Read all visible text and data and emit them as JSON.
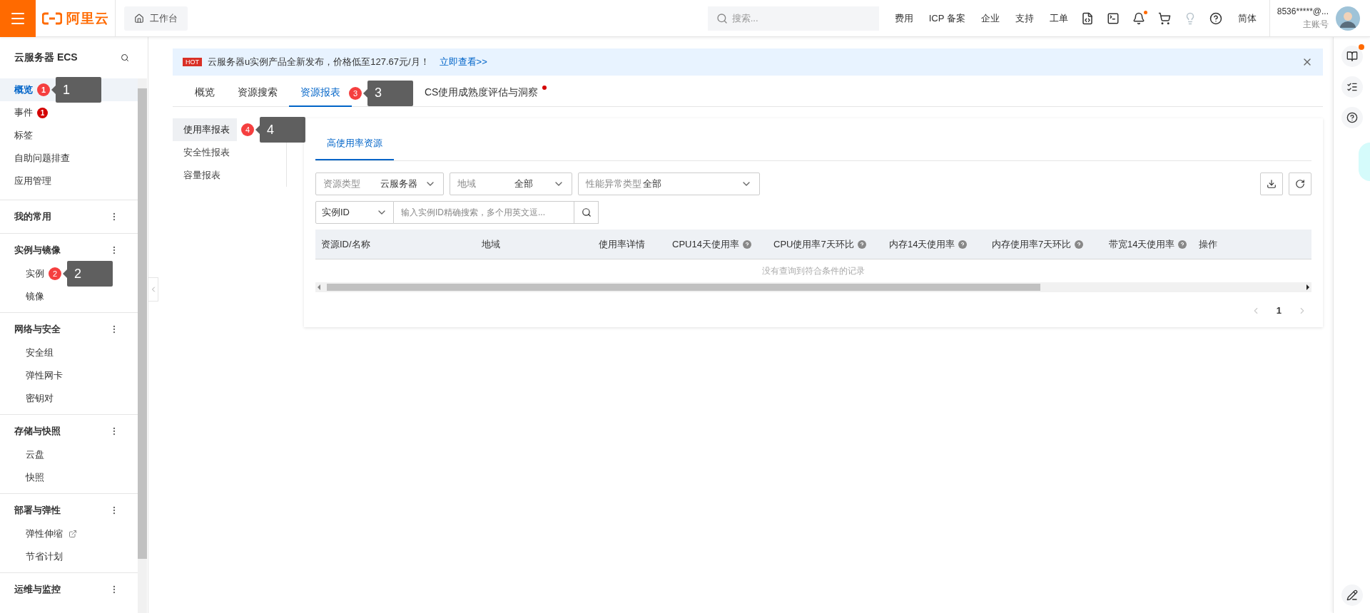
{
  "topbar": {
    "logo_text": "阿里云",
    "workbench": "工作台",
    "search": {
      "placeholder": "搜索..."
    },
    "nav_links": [
      "费用",
      "ICP 备案",
      "企业",
      "支持",
      "工单"
    ],
    "icon_buttons": [
      {
        "kind": "code",
        "dot": false,
        "disabled": false
      },
      {
        "kind": "terminal",
        "dot": false,
        "disabled": false
      },
      {
        "kind": "bell",
        "dot": true,
        "disabled": false
      },
      {
        "kind": "cart",
        "dot": false,
        "disabled": false
      },
      {
        "kind": "bulb",
        "dot": false,
        "disabled": true
      },
      {
        "kind": "help",
        "dot": false,
        "disabled": false
      }
    ],
    "language": "简体",
    "account": {
      "name": "8536*****@...",
      "role": "主账号"
    }
  },
  "sidebar": {
    "title": "云服务器 ECS",
    "items": [
      {
        "label": "概览",
        "selected": true,
        "annotation": {
          "badge": "1",
          "callout": "1"
        }
      },
      {
        "label": "事件",
        "selected": false,
        "count": "1"
      },
      {
        "label": "标签",
        "selected": false
      },
      {
        "label": "自助问题排查",
        "selected": false
      },
      {
        "label": "应用管理",
        "selected": false
      }
    ],
    "groups": [
      {
        "title": "我的常用"
      },
      {
        "title": "实例与镜像",
        "children": [
          {
            "label": "实例",
            "selected": false,
            "annotation": {
              "badge": "2",
              "callout": "2"
            }
          },
          {
            "label": "镜像",
            "selected": false
          }
        ]
      },
      {
        "title": "网络与安全",
        "children": [
          {
            "label": "安全组",
            "selected": false
          },
          {
            "label": "弹性网卡",
            "selected": false
          },
          {
            "label": "密钥对",
            "selected": false
          }
        ]
      },
      {
        "title": "存储与快照",
        "children": [
          {
            "label": "云盘",
            "selected": false
          },
          {
            "label": "快照",
            "selected": false
          }
        ]
      },
      {
        "title": "部署与弹性",
        "children": [
          {
            "label": "弹性伸缩",
            "selected": false,
            "external": true
          },
          {
            "label": "节省计划",
            "selected": false
          }
        ]
      },
      {
        "title": "运维与监控"
      }
    ]
  },
  "banner": {
    "tag": "HOT",
    "text": "云服务器u实例产品全新发布，价格低至127.67元/月！",
    "link": "立即查看>>"
  },
  "tabs": [
    {
      "label": "概览",
      "selected": false
    },
    {
      "label": "资源搜索",
      "selected": false
    },
    {
      "label": "资源报表",
      "selected": true,
      "annotation": {
        "badge": "3",
        "callout": "3"
      }
    },
    {
      "label": "CS使用成熟度评估与洞察",
      "selected": false,
      "dot": true
    }
  ],
  "subnav": [
    {
      "label": "使用率报表",
      "selected": true,
      "annotation": {
        "badge": "4",
        "callout": "4"
      }
    },
    {
      "label": "安全性报表",
      "selected": false
    },
    {
      "label": "容量报表",
      "selected": false
    }
  ],
  "panel": {
    "tabs": [
      {
        "label": "高使用率资源",
        "selected": true
      }
    ],
    "filters": [
      {
        "label": "资源类型",
        "value": "云服务器"
      },
      {
        "label": "地域",
        "value": "全部"
      },
      {
        "label": "性能异常类型",
        "value": "全部"
      }
    ],
    "id_type": "实例ID",
    "id_search": {
      "placeholder": "输入实例ID精确搜索，多个用英文逗..."
    },
    "table": {
      "columns": [
        {
          "label": "资源ID/名称",
          "help": false
        },
        {
          "label": "地域",
          "help": false
        },
        {
          "label": "使用率详情",
          "help": false
        },
        {
          "label": "CPU14天使用率",
          "help": true
        },
        {
          "label": "CPU使用率7天环比",
          "help": true
        },
        {
          "label": "内存14天使用率",
          "help": true
        },
        {
          "label": "内存使用率7天环比",
          "help": true
        },
        {
          "label": "带宽14天使用率",
          "help": true
        },
        {
          "label": "操作",
          "help": false
        }
      ],
      "empty": "没有查询到符合条件的记录"
    },
    "pagination": {
      "pages": [
        {
          "label": "1",
          "selected": true
        }
      ]
    }
  }
}
